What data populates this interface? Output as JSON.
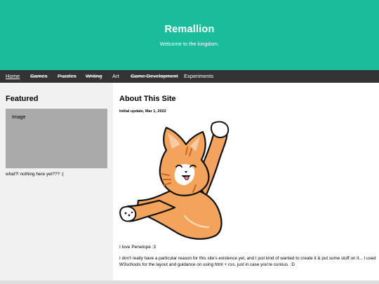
{
  "header": {
    "title": "Remallion",
    "tagline": "Welcome to the kingdom."
  },
  "nav": {
    "items": [
      {
        "label": "Home"
      },
      {
        "label": "Games"
      },
      {
        "label": "Puzzles"
      },
      {
        "label": "Writing"
      },
      {
        "label": "Art"
      },
      {
        "label": "Game Development"
      },
      {
        "label": "Experiments"
      }
    ]
  },
  "sidebar": {
    "heading": "Featured",
    "image_placeholder": "Image",
    "note": "what?! nothing here yet??? :("
  },
  "main": {
    "heading": "About This Site",
    "date": "Initial update, Mar 1, 2022",
    "caption": "I love Penelope :3",
    "body": "I don't really have a particular reason for this site's existence yet, and I just kind of wanted to create it & put some stuff on it... I used W3schools for the layout and guidance on using html + css, just in case you're curious. :D"
  },
  "colors": {
    "header_bg": "#1abc9c",
    "nav_bg": "#333333",
    "side_bg": "#f1f1f1",
    "placeholder_bg": "#aaaaaa",
    "cat_orange": "#f4a35c"
  },
  "icons": {
    "main_image": "orange-cat-illustration"
  }
}
